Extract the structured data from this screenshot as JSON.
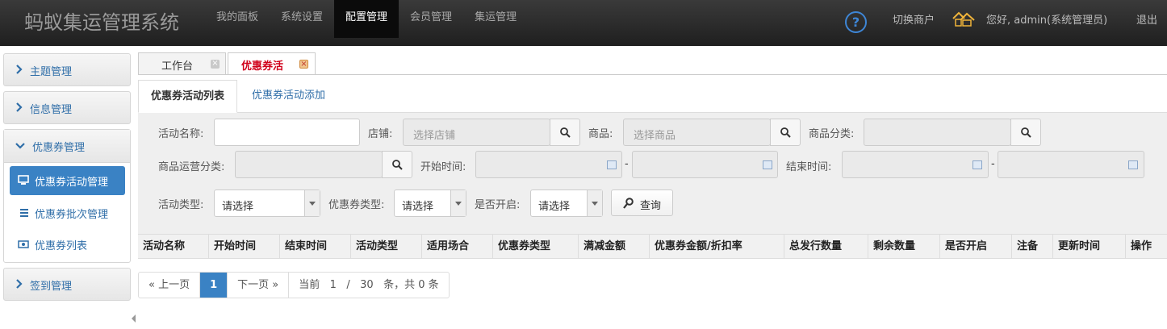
{
  "app": {
    "title": "蚂蚁集运管理系统"
  },
  "nav": [
    {
      "label": "我的面板",
      "active": false
    },
    {
      "label": "系统设置",
      "active": false
    },
    {
      "label": "配置管理",
      "active": true
    },
    {
      "label": "会员管理",
      "active": false
    },
    {
      "label": "集运管理",
      "active": false
    }
  ],
  "header": {
    "help_symbol": "?",
    "switch_merchant": "切换商户",
    "greeting": "您好, admin(系统管理员)",
    "logout": "退出"
  },
  "sidebar": {
    "groups": [
      {
        "label": "主题管理"
      },
      {
        "label": "信息管理"
      },
      {
        "label": "优惠券管理",
        "expanded": true
      },
      {
        "label": "签到管理"
      }
    ],
    "coupon_items": [
      {
        "label": "优惠券活动管理",
        "active": true,
        "icon": "monitor-icon"
      },
      {
        "label": "优惠券批次管理",
        "active": false,
        "icon": "list-icon"
      },
      {
        "label": "优惠券列表",
        "active": false,
        "icon": "coupon-icon"
      }
    ]
  },
  "page_tabs": [
    {
      "label": "工作台",
      "close": "×"
    },
    {
      "label": "优惠券活",
      "close": "×",
      "active": true
    }
  ],
  "sub_tabs": [
    {
      "label": "优惠券活动列表",
      "active": true
    },
    {
      "label": "优惠券活动添加",
      "active": false
    }
  ],
  "filters": {
    "activity_name": {
      "label": "活动名称:",
      "value": ""
    },
    "store": {
      "label": "店铺:",
      "placeholder": "选择店铺"
    },
    "product": {
      "label": "商品:",
      "placeholder": "选择商品"
    },
    "product_category": {
      "label": "商品分类:",
      "placeholder": ""
    },
    "ops_category": {
      "label": "商品运营分类:",
      "placeholder": ""
    },
    "start_time": {
      "label": "开始时间:",
      "separator": "-"
    },
    "end_time": {
      "label": "结束时间:",
      "separator": "-"
    },
    "activity_type": {
      "label": "活动类型:",
      "value": "请选择"
    },
    "coupon_type": {
      "label": "优惠券类型:",
      "value": "请选择"
    },
    "is_enabled": {
      "label": "是否开启:",
      "value": "请选择"
    },
    "query_button": "查询"
  },
  "table": {
    "columns": [
      "活动名称",
      "开始时间",
      "结束时间",
      "活动类型",
      "适用场合",
      "优惠券类型",
      "满减金额",
      "优惠券金额/折扣率",
      "总发行数量",
      "剩余数量",
      "是否开启",
      "注备",
      "更新时间",
      "操作"
    ],
    "rows": []
  },
  "pagination": {
    "prev": "« 上一页",
    "current": "1",
    "next": "下一页 »",
    "info_prefix": "当前",
    "page": "1",
    "slash": "/",
    "total_pages": "30",
    "info_suffix": "条，共 0 条"
  },
  "colors": {
    "accent": "#3a82c4",
    "topbar": "#2a2a2a",
    "active_tab_text": "#d0021b"
  }
}
